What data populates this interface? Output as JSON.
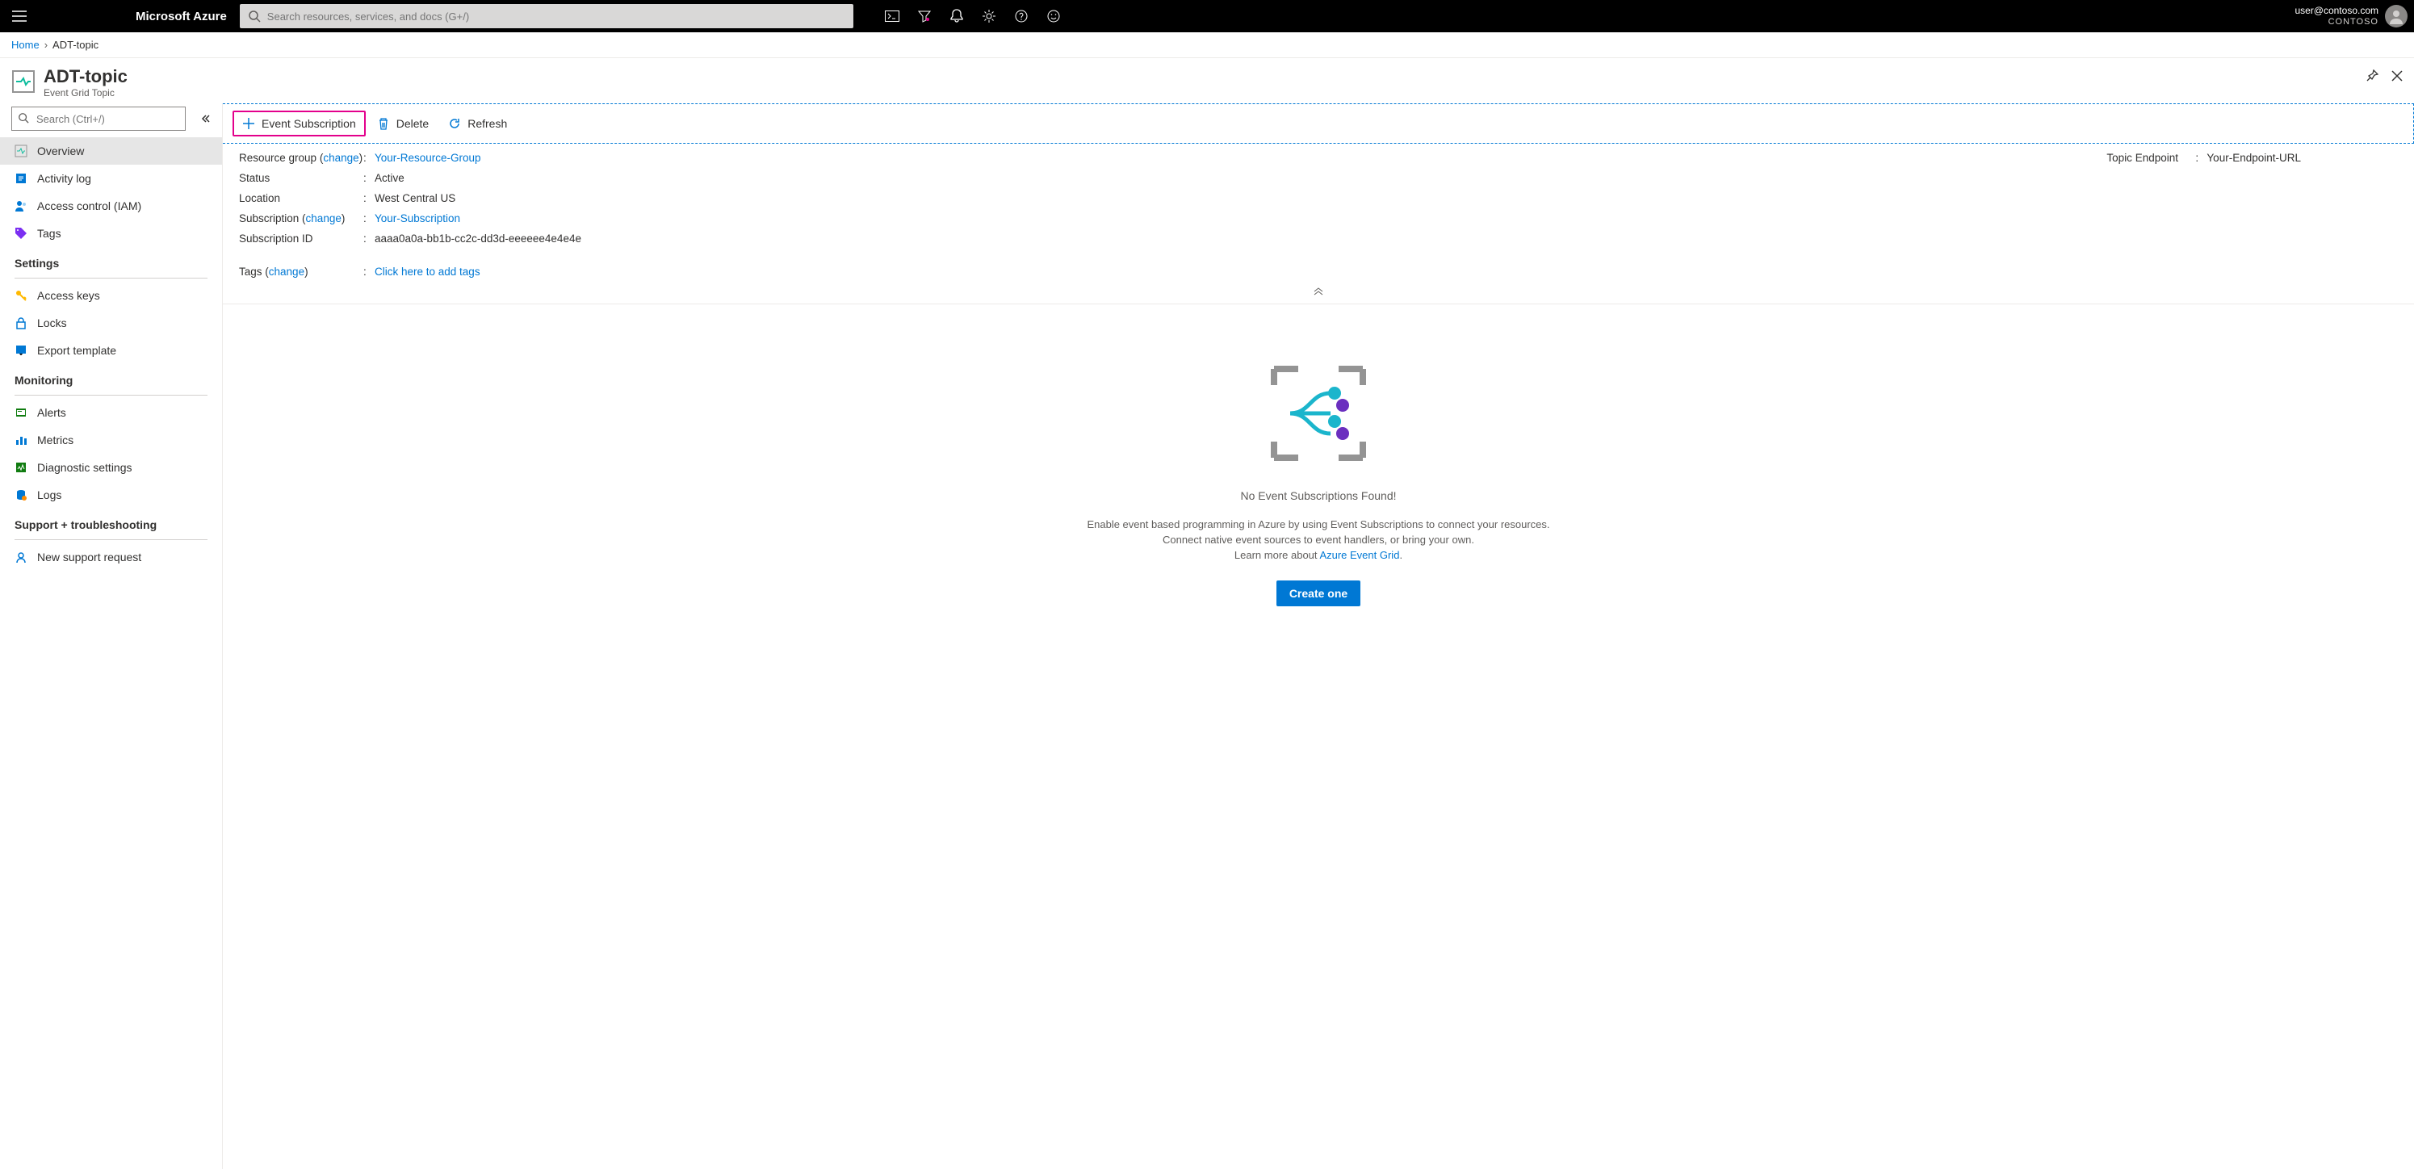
{
  "topbar": {
    "brand": "Microsoft Azure",
    "search_placeholder": "Search resources, services, and docs (G+/)",
    "user_email": "user@contoso.com",
    "tenant": "CONTOSO"
  },
  "breadcrumb": {
    "home": "Home",
    "current": "ADT-topic"
  },
  "header": {
    "title": "ADT-topic",
    "subtitle": "Event Grid Topic"
  },
  "sidebar": {
    "search_placeholder": "Search (Ctrl+/)",
    "top_items": [
      {
        "label": "Overview",
        "selected": true
      },
      {
        "label": "Activity log"
      },
      {
        "label": "Access control (IAM)"
      },
      {
        "label": "Tags"
      }
    ],
    "groups": [
      {
        "label": "Settings",
        "items": [
          {
            "label": "Access keys"
          },
          {
            "label": "Locks"
          },
          {
            "label": "Export template"
          }
        ]
      },
      {
        "label": "Monitoring",
        "items": [
          {
            "label": "Alerts"
          },
          {
            "label": "Metrics"
          },
          {
            "label": "Diagnostic settings"
          },
          {
            "label": "Logs"
          }
        ]
      },
      {
        "label": "Support + troubleshooting",
        "items": [
          {
            "label": "New support request"
          }
        ]
      }
    ]
  },
  "toolbar": {
    "event_sub": "Event Subscription",
    "delete": "Delete",
    "refresh": "Refresh"
  },
  "essentials": {
    "rg_label": "Resource group",
    "rg_change": "change",
    "rg_value": "Your-Resource-Group",
    "status_label": "Status",
    "status_value": "Active",
    "location_label": "Location",
    "location_value": "West Central US",
    "sub_label": "Subscription",
    "sub_change": "change",
    "sub_value": "Your-Subscription",
    "subid_label": "Subscription ID",
    "subid_value": "aaaa0a0a-bb1b-cc2c-dd3d-eeeeee4e4e4e",
    "tags_label": "Tags",
    "tags_change": "change",
    "tags_value": "Click here to add tags",
    "endpoint_label": "Topic Endpoint",
    "endpoint_value": "Your-Endpoint-URL"
  },
  "empty": {
    "title": "No Event Subscriptions Found!",
    "desc1": "Enable event based programming in Azure by using Event Subscriptions to connect your resources.",
    "desc2": "Connect native event sources to event handlers, or bring your own.",
    "learn": "Learn more about ",
    "learn_link": "Azure Event Grid",
    "create": "Create one"
  }
}
